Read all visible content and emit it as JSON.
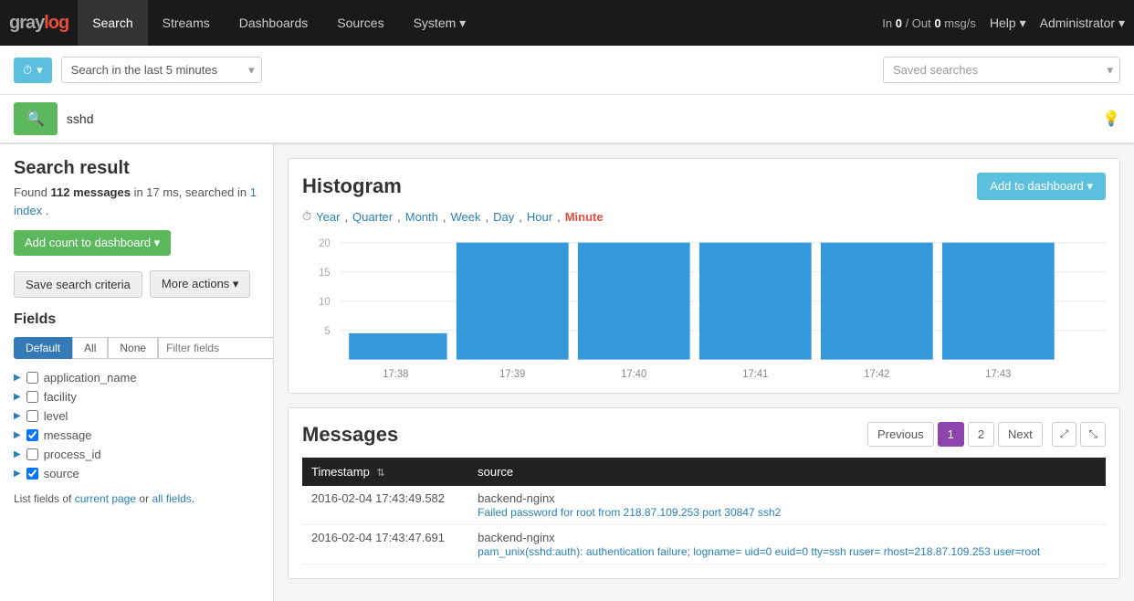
{
  "brand": {
    "gray": "gray",
    "log": "log"
  },
  "navbar": {
    "items": [
      {
        "id": "search",
        "label": "Search",
        "active": true
      },
      {
        "id": "streams",
        "label": "Streams",
        "active": false
      },
      {
        "id": "dashboards",
        "label": "Dashboards",
        "active": false
      },
      {
        "id": "sources",
        "label": "Sources",
        "active": false
      },
      {
        "id": "system",
        "label": "System ▾",
        "active": false
      }
    ],
    "stat_label": "In ",
    "stat_in": "0",
    "stat_sep": " / Out ",
    "stat_out": "0",
    "stat_unit": " msg/s",
    "help": "Help ▾",
    "admin": "Administrator ▾"
  },
  "search_bar": {
    "time_btn_icon": "⏱",
    "time_value": "Search in the last 5 minutes",
    "saved_searches_placeholder": "Saved searches"
  },
  "search_input": {
    "search_icon": "🔍",
    "query": "sshd",
    "hint_icon": "💡"
  },
  "sidebar": {
    "result_title": "Search result",
    "found_label": "Found ",
    "found_count": "112 messages",
    "found_meta": " in 17 ms, searched in ",
    "index_count": "1 index",
    "period": ".",
    "add_count_btn": "Add count to dashboard ▾",
    "save_criteria_btn": "Save search criteria",
    "more_actions_btn": "More actions ▾",
    "fields_title": "Fields",
    "tabs": [
      "Default",
      "All",
      "None"
    ],
    "filter_placeholder": "Filter fields",
    "fields": [
      {
        "id": "application_name",
        "label": "application_name",
        "checked": false
      },
      {
        "id": "facility",
        "label": "facility",
        "checked": false
      },
      {
        "id": "level",
        "label": "level",
        "checked": false
      },
      {
        "id": "message",
        "label": "message",
        "checked": true
      },
      {
        "id": "process_id",
        "label": "process_id",
        "checked": false
      },
      {
        "id": "source",
        "label": "source",
        "checked": true
      }
    ],
    "field_meta": "List fields of ",
    "current_page": "current page",
    "or_text": " or ",
    "all_fields": "all fields",
    "field_meta_end": "."
  },
  "histogram": {
    "title": "Histogram",
    "add_btn": "Add to dashboard ▾",
    "intervals": [
      "Year",
      "Quarter",
      "Month",
      "Week",
      "Day",
      "Hour",
      "Minute"
    ],
    "active_interval": "Minute",
    "bars": [
      {
        "label": "17:38",
        "value": 5
      },
      {
        "label": "17:39",
        "value": 22
      },
      {
        "label": "17:40",
        "value": 22
      },
      {
        "label": "17:41",
        "value": 22
      },
      {
        "label": "17:42",
        "value": 22
      },
      {
        "label": "17:43",
        "value": 22
      }
    ],
    "y_labels": [
      "20",
      "15",
      "10",
      "5"
    ],
    "max_value": 25
  },
  "messages": {
    "title": "Messages",
    "pagination": {
      "prev": "Previous",
      "pages": [
        "1",
        "2"
      ],
      "active_page": "1",
      "next": "Next"
    },
    "columns": [
      "Timestamp",
      "source"
    ],
    "rows": [
      {
        "timestamp": "2016-02-04 17:43:49.582",
        "source": "backend-nginx",
        "detail": "Failed password for root from 218.87.109.253 port 30847 ssh2"
      },
      {
        "timestamp": "2016-02-04 17:43:47.691",
        "source": "backend-nginx",
        "detail": "pam_unix(sshd:auth): authentication failure; logname= uid=0 euid=0 tty=ssh ruser= rhost=218.87.109.253 user=root"
      }
    ]
  }
}
